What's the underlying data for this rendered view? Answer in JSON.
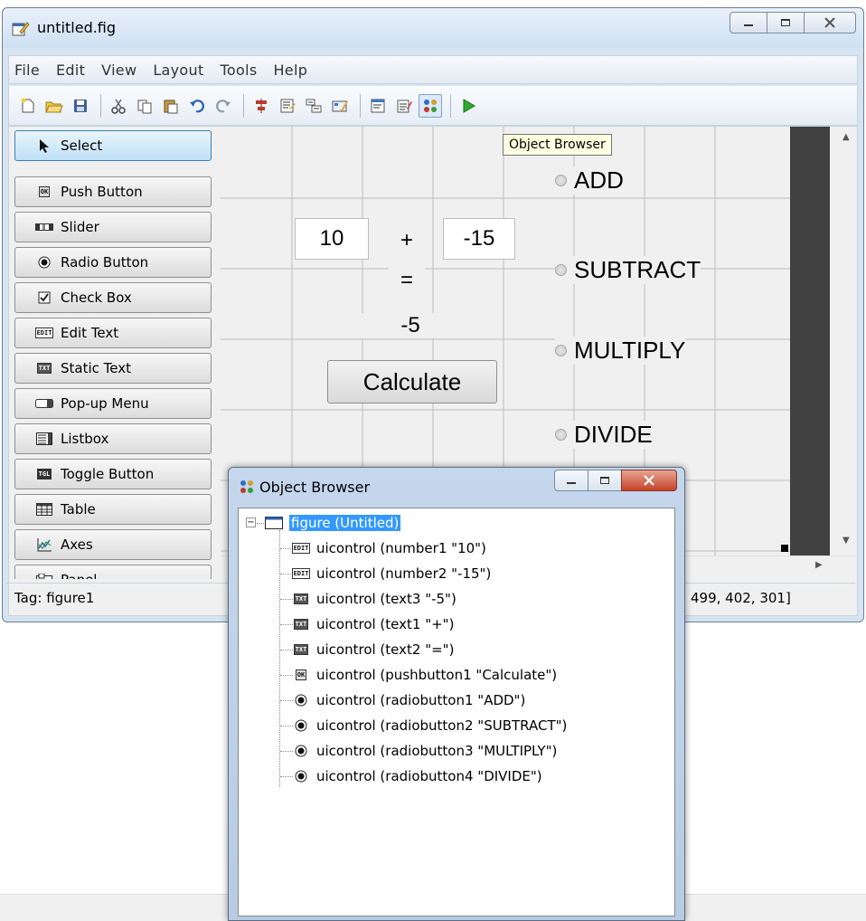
{
  "window": {
    "title": "untitled.fig",
    "icon": "guide-figure-icon",
    "controls": [
      "minimize",
      "maximize",
      "close"
    ]
  },
  "menu": [
    "File",
    "Edit",
    "View",
    "Layout",
    "Tools",
    "Help"
  ],
  "toolbar": [
    {
      "name": "new-figure-icon"
    },
    {
      "name": "open-file-icon"
    },
    {
      "name": "save-icon"
    },
    {
      "sep": true
    },
    {
      "name": "cut-icon"
    },
    {
      "name": "copy-icon"
    },
    {
      "name": "paste-icon"
    },
    {
      "name": "undo-icon"
    },
    {
      "name": "redo-icon"
    },
    {
      "sep": true
    },
    {
      "name": "align-objects-icon"
    },
    {
      "name": "menu-editor-icon"
    },
    {
      "name": "tab-order-editor-icon"
    },
    {
      "name": "toolbar-editor-icon"
    },
    {
      "sep": true
    },
    {
      "name": "editor-icon"
    },
    {
      "name": "property-inspector-icon"
    },
    {
      "name": "object-browser-icon",
      "active": true
    },
    {
      "sep": true
    },
    {
      "name": "run-figure-icon"
    }
  ],
  "palette": [
    {
      "label": "Select",
      "icon": "arrow",
      "selected": true
    },
    {
      "label": "Push Button",
      "icon": "OK"
    },
    {
      "label": "Slider",
      "icon": "slider"
    },
    {
      "label": "Radio Button",
      "icon": "radio"
    },
    {
      "label": "Check Box",
      "icon": "check"
    },
    {
      "label": "Edit Text",
      "icon": "EDIT"
    },
    {
      "label": "Static Text",
      "icon": "TXT"
    },
    {
      "label": "Pop-up Menu",
      "icon": "popup"
    },
    {
      "label": "Listbox",
      "icon": "listbox"
    },
    {
      "label": "Toggle Button",
      "icon": "TGL"
    },
    {
      "label": "Table",
      "icon": "table"
    },
    {
      "label": "Axes",
      "icon": "axes"
    },
    {
      "label": "Panel",
      "icon": "panel"
    }
  ],
  "canvas": {
    "number1": "10",
    "plus": "+",
    "number2": "-15",
    "equals": "=",
    "result": "-5",
    "calculate": "Calculate",
    "radios": [
      "ADD",
      "SUBTRACT",
      "MULTIPLY",
      "DIVIDE"
    ]
  },
  "tooltip": "Object Browser",
  "status": {
    "tag": "Tag: figure1",
    "position_text": "499, 402, 301]"
  },
  "object_browser": {
    "title": "Object Browser",
    "root": "figure (Untitled)",
    "items": [
      {
        "icon": "EDIT",
        "label": "uicontrol (number1 \"10\")"
      },
      {
        "icon": "EDIT",
        "label": "uicontrol (number2 \"-15\")"
      },
      {
        "icon": "TXT",
        "label": "uicontrol (text3 \"-5\")"
      },
      {
        "icon": "TXT",
        "label": "uicontrol (text1 \"+\")"
      },
      {
        "icon": "TXT",
        "label": "uicontrol (text2 \"=\")"
      },
      {
        "icon": "OK",
        "label": "uicontrol (pushbutton1 \"Calculate\")"
      },
      {
        "icon": "radio",
        "label": "uicontrol (radiobutton1 \"ADD\")"
      },
      {
        "icon": "radio",
        "label": "uicontrol (radiobutton2 \"SUBTRACT\")"
      },
      {
        "icon": "radio",
        "label": "uicontrol (radiobutton3 \"MULTIPLY\")"
      },
      {
        "icon": "radio",
        "label": "uicontrol (radiobutton4 \"DIVIDE\")"
      }
    ]
  }
}
